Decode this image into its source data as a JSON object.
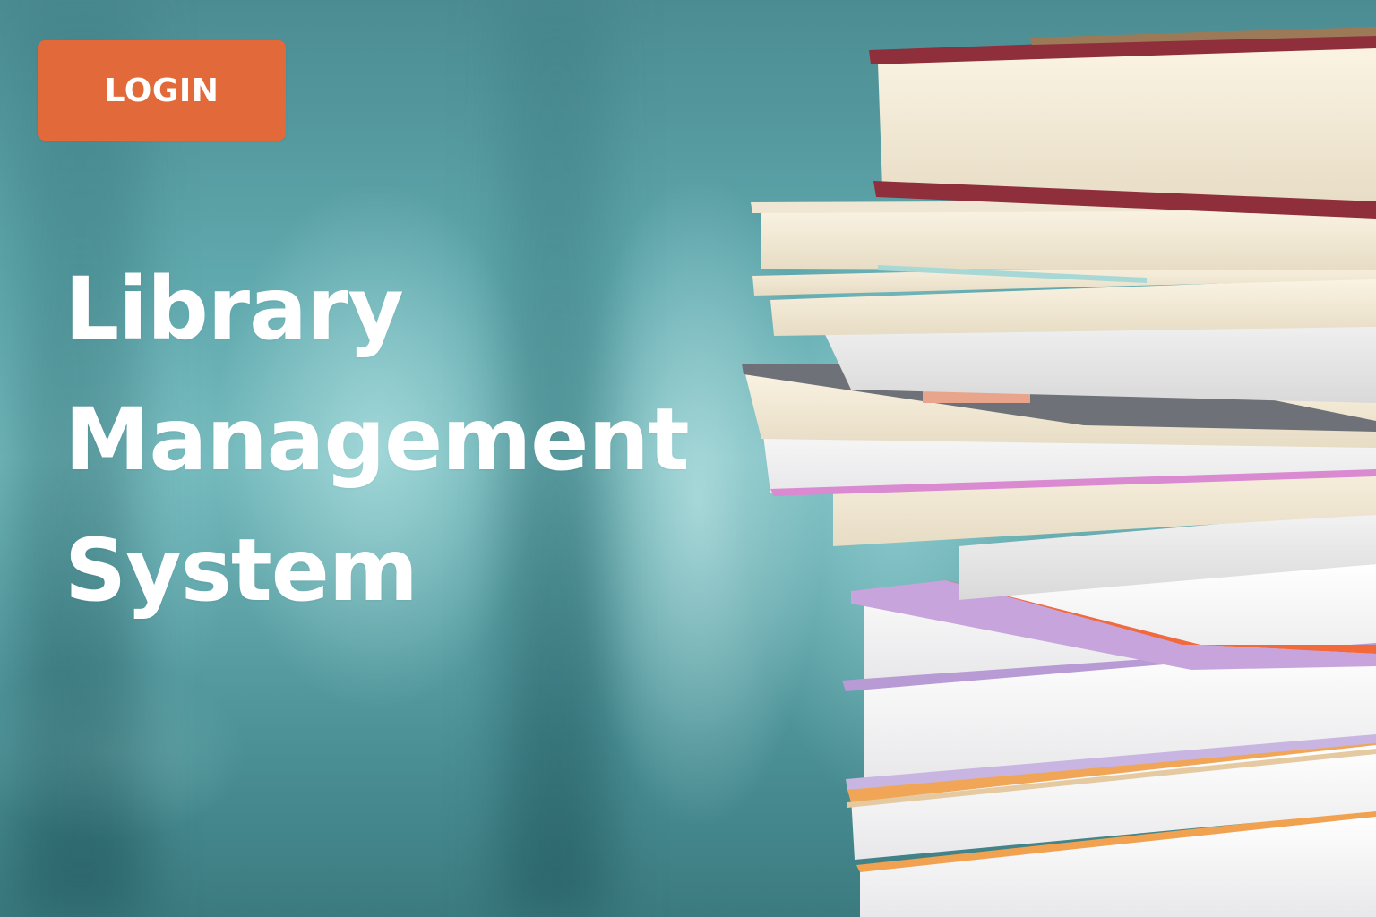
{
  "login_button": {
    "label": "LOGIN",
    "color": "#e2693a"
  },
  "hero": {
    "title_lines": [
      "Library",
      "Management",
      "System"
    ]
  },
  "background": {
    "color": "#5fa8ad"
  },
  "image": {
    "subject": "stack-of-books"
  }
}
